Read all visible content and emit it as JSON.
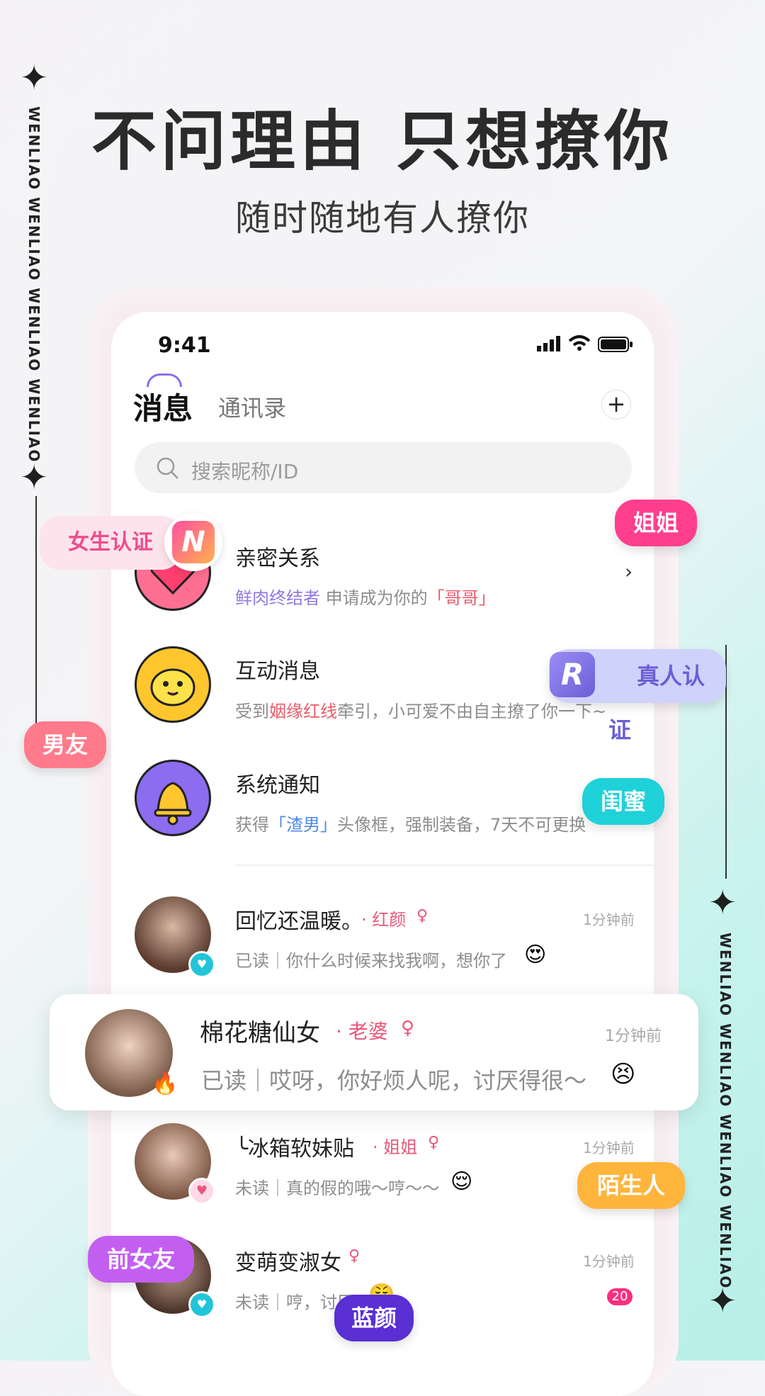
{
  "headline": "不问理由  只想撩你",
  "subheadline": "随时随地有人撩你",
  "side_text": "WENLIAO  WENLIAO  WENLIAO  WENLIAO",
  "status": {
    "time": "9:41"
  },
  "tabs": {
    "active": "消息",
    "inactive": "通讯录",
    "add": "+"
  },
  "search": {
    "placeholder": "搜索昵称/ID"
  },
  "system_rows": [
    {
      "title": "亲密关系",
      "sub_a": "鲜肉终结者",
      "sub_b": " 申请成为你的",
      "sub_c": "「哥哥」",
      "chevron": "›"
    },
    {
      "title": "互动消息",
      "sub_a": "受到",
      "sub_b": "姻缘红线",
      "sub_c": "牵引，小可爱不由自主撩了你一下~"
    },
    {
      "title": "系统通知",
      "sub_a": "获得",
      "sub_b": "「渣男」",
      "sub_c": "头像框，强制装备，7天不可更换"
    }
  ],
  "chats": [
    {
      "name": "回忆还温暖。",
      "tag": "· 红颜",
      "time": "1分钟前",
      "preview": "已读｜你什么时候来找我啊，想你了",
      "emoji": "😍"
    },
    {
      "name": "棉花糖仙女",
      "tag": "· 老婆",
      "time": "1分钟前",
      "preview": "已读｜哎呀，你好烦人呢，讨厌得很～",
      "emoji": "😣"
    },
    {
      "name": "╰冰箱软妹贴",
      "tag": "· 姐姐",
      "time": "1分钟前",
      "preview": "未读｜真的假的哦～哼～～",
      "emoji": "😌"
    },
    {
      "name": "变萌变淑女",
      "tag": "",
      "time": "1分钟前",
      "preview": "未读｜哼，讨厌",
      "emoji": "😤",
      "badge": "20"
    }
  ],
  "floating_tags": {
    "girl_verify": "女生认证",
    "girl_verify_icon": "N",
    "real_verify": "真人认证",
    "real_verify_icon": "R",
    "jiejie": "姐姐",
    "nanyou": "男友",
    "guimi": "闺蜜",
    "moshengren": "陌生人",
    "qiannvyou": "前女友",
    "lanyan": "蓝颜"
  },
  "colors": {
    "accent": "#ff3f8e",
    "purple": "#8a6ee8",
    "link_purple": "#8f79e0",
    "link_red": "#e95b6b",
    "link_blue": "#4d88e8"
  }
}
